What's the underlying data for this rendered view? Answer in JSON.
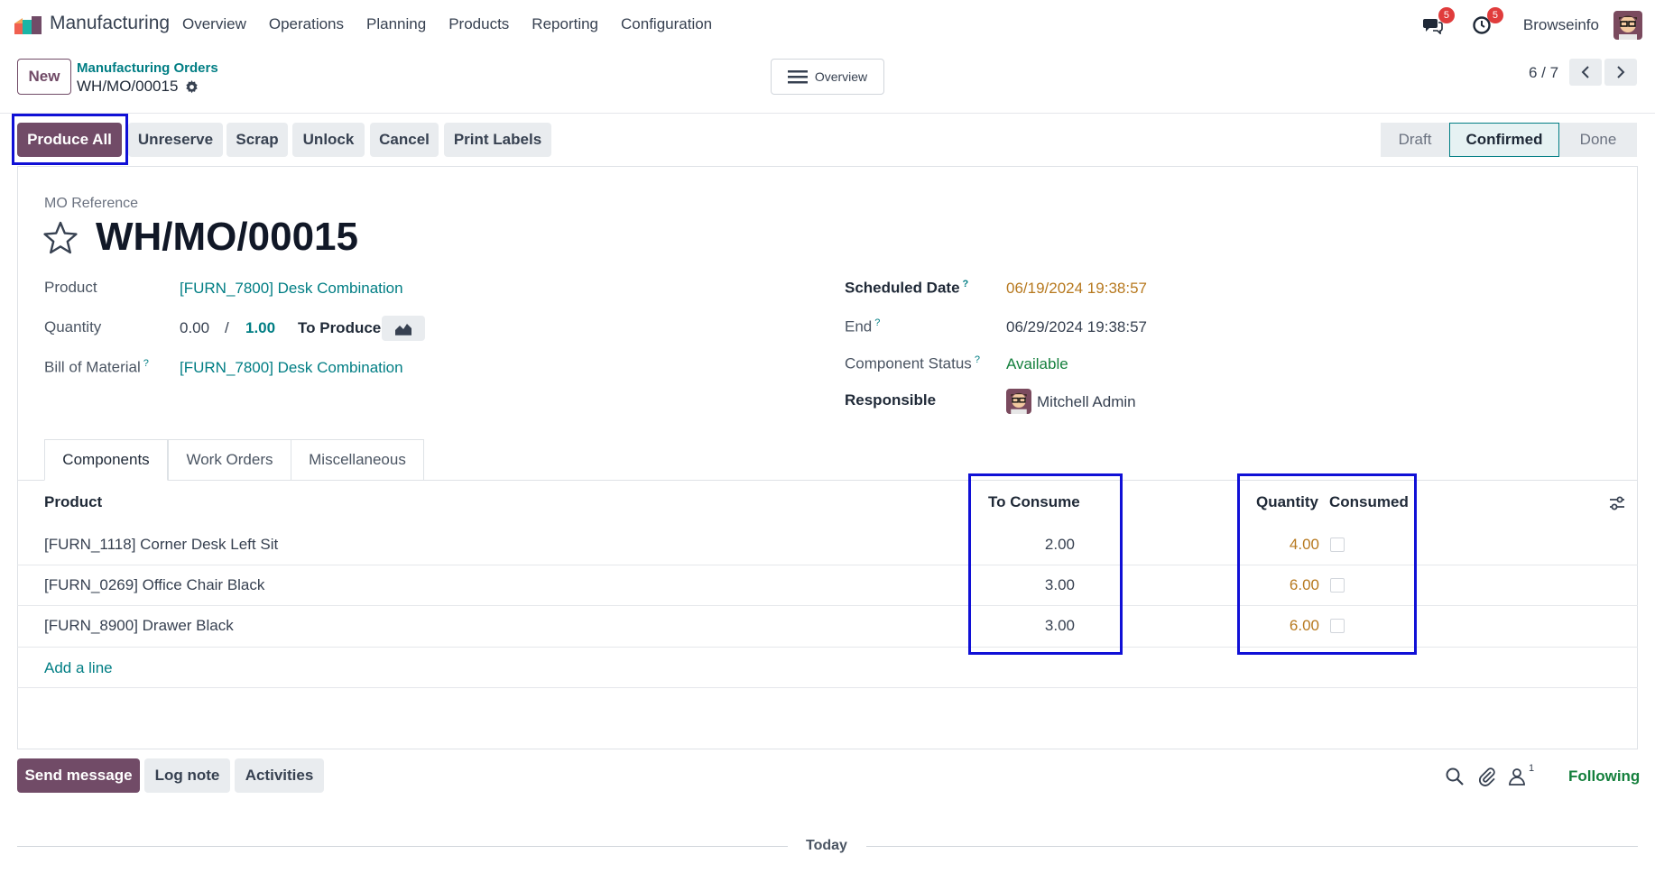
{
  "navbar": {
    "app_name": "Manufacturing",
    "menu": [
      "Overview",
      "Operations",
      "Planning",
      "Products",
      "Reporting",
      "Configuration"
    ],
    "messages_badge": "5",
    "activities_badge": "5",
    "user_name": "Browseinfo"
  },
  "control_panel": {
    "new_label": "New",
    "breadcrumb_parent": "Manufacturing Orders",
    "breadcrumb_current": "WH/MO/00015",
    "overview_label": "Overview",
    "pager": "6 / 7"
  },
  "actions": {
    "produce_all": "Produce All",
    "unreserve": "Unreserve",
    "scrap": "Scrap",
    "unlock": "Unlock",
    "cancel": "Cancel",
    "print_labels": "Print Labels"
  },
  "status": {
    "stages": [
      "Draft",
      "Confirmed",
      "Done"
    ],
    "current": "Confirmed"
  },
  "form": {
    "mo_reference_label": "MO Reference",
    "reference": "WH/MO/00015",
    "product_label": "Product",
    "product_value": "[FURN_7800] Desk Combination",
    "quantity_label": "Quantity",
    "quantity_done": "0.00",
    "quantity_sep": "/",
    "quantity_total": "1.00",
    "to_produce_label": "To Produce",
    "bom_label": "Bill of Material",
    "bom_value": "[FURN_7800] Desk Combination",
    "scheduled_date_label": "Scheduled Date",
    "scheduled_date_value": "06/19/2024 19:38:57",
    "end_label": "End",
    "end_value": "06/29/2024 19:38:57",
    "component_status_label": "Component Status",
    "component_status_value": "Available",
    "responsible_label": "Responsible",
    "responsible_value": "Mitchell Admin",
    "help_mark": "?"
  },
  "tabs": [
    "Components",
    "Work Orders",
    "Miscellaneous"
  ],
  "components_table": {
    "headers": {
      "product": "Product",
      "to_consume": "To Consume",
      "quantity": "Quantity",
      "consumed": "Consumed"
    },
    "rows": [
      {
        "product": "[FURN_1118] Corner Desk Left Sit",
        "to_consume": "2.00",
        "quantity": "4.00",
        "consumed": false
      },
      {
        "product": "[FURN_0269] Office Chair Black",
        "to_consume": "3.00",
        "quantity": "6.00",
        "consumed": false
      },
      {
        "product": "[FURN_8900] Drawer Black",
        "to_consume": "3.00",
        "quantity": "6.00",
        "consumed": false
      }
    ],
    "add_line": "Add a line"
  },
  "chatter": {
    "send_message": "Send message",
    "log_note": "Log note",
    "activities": "Activities",
    "followers_count": "1",
    "following": "Following",
    "today": "Today"
  },
  "colors": {
    "brand": "#714b67",
    "link": "#017e84",
    "warning": "#b7791f",
    "success": "#15803d",
    "highlight": "#1010d6"
  }
}
